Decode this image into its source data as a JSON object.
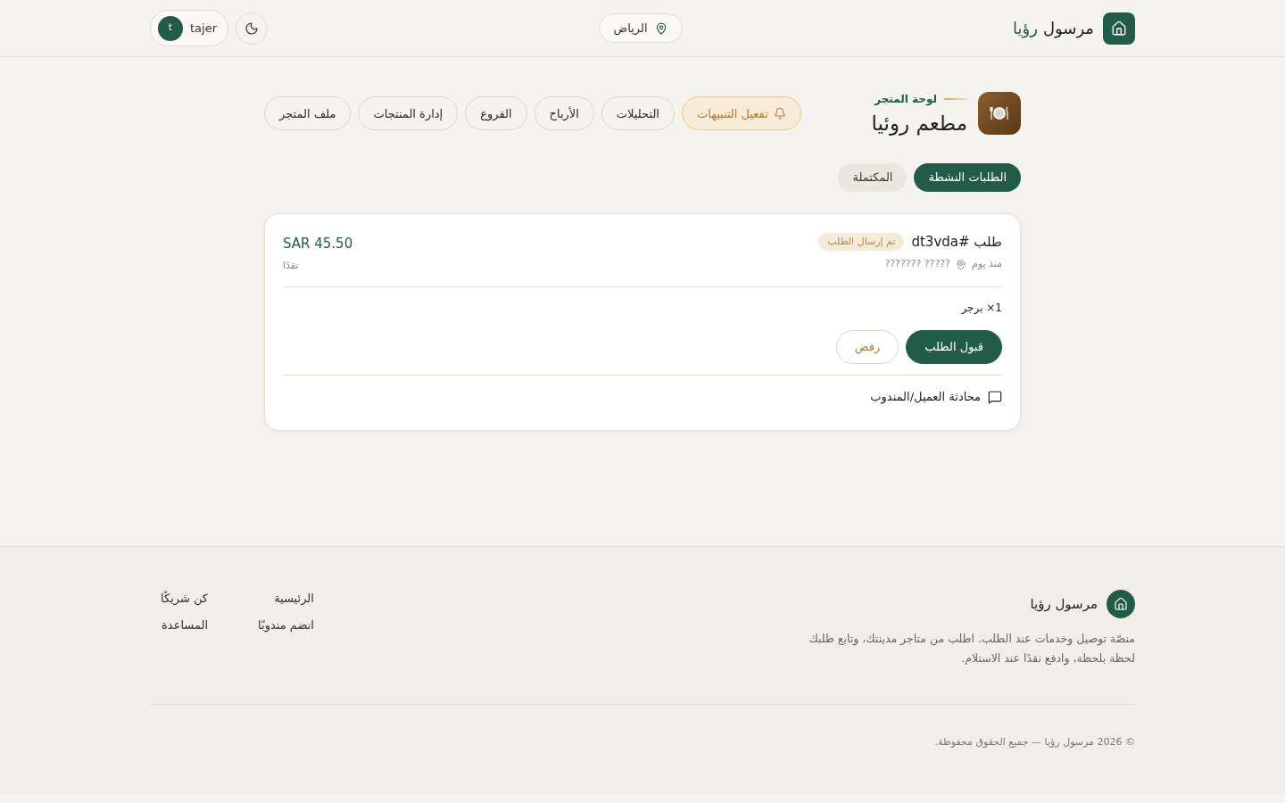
{
  "header": {
    "brand": {
      "name": "مرسول",
      "accent": "رؤيا"
    },
    "location": "الرياض",
    "user": {
      "initial": "t",
      "name": "tajer"
    }
  },
  "store": {
    "eyebrow": "لوحة المتجر",
    "name": "مطعم روئيا"
  },
  "nav": [
    {
      "label": "تفعيل التنبيهات",
      "kind": "alert"
    },
    {
      "label": "التحليلات",
      "kind": "link"
    },
    {
      "label": "الأرباح",
      "kind": "link"
    },
    {
      "label": "الفروع",
      "kind": "link"
    },
    {
      "label": "إدارة المنتجات",
      "kind": "link"
    },
    {
      "label": "ملف المتجر",
      "kind": "link"
    }
  ],
  "tabs": [
    {
      "label": "الطلبات النشطة",
      "selected": true
    },
    {
      "label": "المكتملة",
      "selected": false
    }
  ],
  "orders": [
    {
      "title": "طلب #dt3vda",
      "status": "تم إرسال الطلب",
      "time": "منذ يوم",
      "address": "????? ???????",
      "total": "SAR 45.50",
      "payment": "نقدًا",
      "items": [
        "1× برجر"
      ],
      "actions": [
        {
          "label": "قبول الطلب",
          "kind": "primary"
        },
        {
          "label": "رفض",
          "kind": "secondary"
        }
      ],
      "chat": "محادثة العميل/المندوب"
    }
  ],
  "footer": {
    "brand": "مرسول رؤيا",
    "description": "منصّة توصيل وخدمات عند الطلب. اطلب من متاجر مدينتك، وتابع طلبك لحظة بلحظة، وادفع نقدًا عند الاستلام.",
    "link_columns": [
      [
        "الرئيسية",
        "انضم مندوبًا"
      ],
      [
        "كن شريكًا",
        "المساعدة"
      ]
    ],
    "copyright": "© 2026 مرسول رؤيا — جميع الحقوق محفوظة."
  }
}
